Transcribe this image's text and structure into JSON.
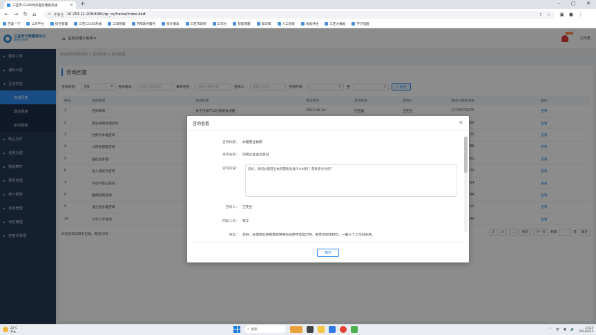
{
  "browser": {
    "tab_title": "三亚市12345政务服务便民热线",
    "url": "10.253.11.208:8081/zp_cs/frame/index.do#",
    "url_warning": "不安全",
    "bookmarks": [
      "百度一下",
      "公司平台",
      "综合管理",
      "三亚12345热线",
      "工单管理",
      "河南政务服务",
      "统计报表",
      "三亚市政府",
      "工作台",
      "智能客服",
      "知识库",
      "人工智能",
      "效能评估",
      "三亚大数据",
      "学习强国"
    ]
  },
  "app": {
    "logo_line1": "三亚市行政服务中心",
    "logo_line2": "政务e咨询",
    "system_menu": "业务办理子系统 ▾",
    "notification_count": "139",
    "username": "工作员"
  },
  "sidebar": {
    "items": [
      {
        "label": "我的工单",
        "expanded": false
      },
      {
        "label": "通知公告",
        "expanded": false
      },
      {
        "label": "互动交流",
        "expanded": true,
        "children": [
          "咨询回复",
          "建议回复",
          "投诉回复"
        ]
      },
      {
        "label": "网上办件",
        "expanded": false
      },
      {
        "label": "证照办理",
        "expanded": false
      },
      {
        "label": "物流寄件",
        "expanded": false
      },
      {
        "label": "事项管理",
        "expanded": false
      },
      {
        "label": "统计报表",
        "expanded": false
      },
      {
        "label": "系统管理",
        "expanded": false
      },
      {
        "label": "日志管理",
        "expanded": false
      },
      {
        "label": "好差评管理",
        "expanded": false
      }
    ],
    "active_child": "咨询回复"
  },
  "breadcrumb": "综合服务系统首页 > 互动交流 > 咨询回复",
  "page_title": "咨询回复",
  "filters": {
    "status_label": "咨询状态：",
    "status_value": "全部",
    "phone_label": "咨询电话：",
    "phone_placeholder": "请输入咨询电话",
    "item_label": "事项名称：",
    "item_placeholder": "请输入事项名称",
    "person_label": "咨询人：",
    "person_placeholder": "请输入咨询人",
    "time_label": "咨询时间：",
    "time_to": "至",
    "search_button": "查询"
  },
  "table": {
    "headers": [
      "序号",
      "咨询事项",
      "咨询标题",
      "咨询时间",
      "咨询状态",
      "咨询人",
      "咨询人联系电话",
      "操作"
    ],
    "rows": [
      [
        "1",
        "咨询事项",
        "关于咨询户口迁移相关问题",
        "2023-04-14",
        "已回复",
        "王先生",
        "13735579275",
        "查看"
      ],
      [
        "2",
        "营业执照办理咨询",
        "关于营业执照办理流程",
        "2023-04-13",
        "已回复",
        "李女士",
        "15716218810",
        "查看"
      ],
      [
        "3",
        "社保卡办理咨询",
        "关于社保卡补办问题",
        "2023-04-13",
        "已回复",
        "张先生",
        "18871182575",
        "查看"
      ],
      [
        "4",
        "公积金提取咨询",
        "关于公积金提取条件",
        "2023-04-12",
        "已回复",
        "刘女士",
        "15977695786",
        "查看"
      ],
      [
        "5",
        "居住证办理",
        "关于居住证办理材料",
        "2023-04-12",
        "已回复",
        "陈先生",
        "18256786161",
        "查看"
      ],
      [
        "6",
        "出入境证件咨询",
        "关于护照办理时限",
        "2023-04-11",
        "已回复",
        "赵女士",
        "15546217533",
        "查看"
      ],
      [
        "7",
        "不动产登记咨询",
        "关于不动产过户流程",
        "2023-04-11",
        "已回复",
        "孙先生",
        "15316027714",
        "查看"
      ],
      [
        "8",
        "医保报销咨询",
        "关于异地医保报销",
        "2023-04-10",
        "已回复",
        "周女士",
        "15627103784",
        "查看"
      ],
      [
        "9",
        "准生证办理咨询",
        "关于准生证办理材料",
        "2023-04-10",
        "已回复",
        "吴先生",
        "15626779610",
        "查看"
      ],
      [
        "10",
        "小学入学咨询",
        "关于小学入学报名",
        "2023-04-09",
        "已回复",
        "郑女士",
        "15037852140",
        "查看"
      ]
    ]
  },
  "summary": "共查询到298条记录，每页10条",
  "pager": [
    "3",
    "4",
    "...",
    "尾页",
    "下一页",
    "到第",
    "页",
    "确定"
  ],
  "modal": {
    "title": "咨询查看",
    "close_icon": "close-icon",
    "fields": [
      {
        "label": "咨询标题：",
        "value": "办理营业执照"
      },
      {
        "label": "事项名称：",
        "value": "内资企业设立登记"
      }
    ],
    "content_label": "咨询内容：",
    "content_value": "您好，请问办理营业执照需要准备什么材料？需要多长时间？",
    "fields2": [
      {
        "label": "咨询人：",
        "value": "王先生"
      },
      {
        "label": "回复人员：",
        "value": "张工"
      },
      {
        "label": "回复：",
        "value": "您好，办理营业执照需携带身份证原件及复印件、租赁合同等材料，一般三个工作日办结。"
      }
    ],
    "confirm_button": "确定"
  },
  "taskbar": {
    "weather_temp": "24°C",
    "weather_desc": "多云",
    "search_placeholder": "搜索",
    "time": "14:23",
    "date": "2023/4/14"
  }
}
